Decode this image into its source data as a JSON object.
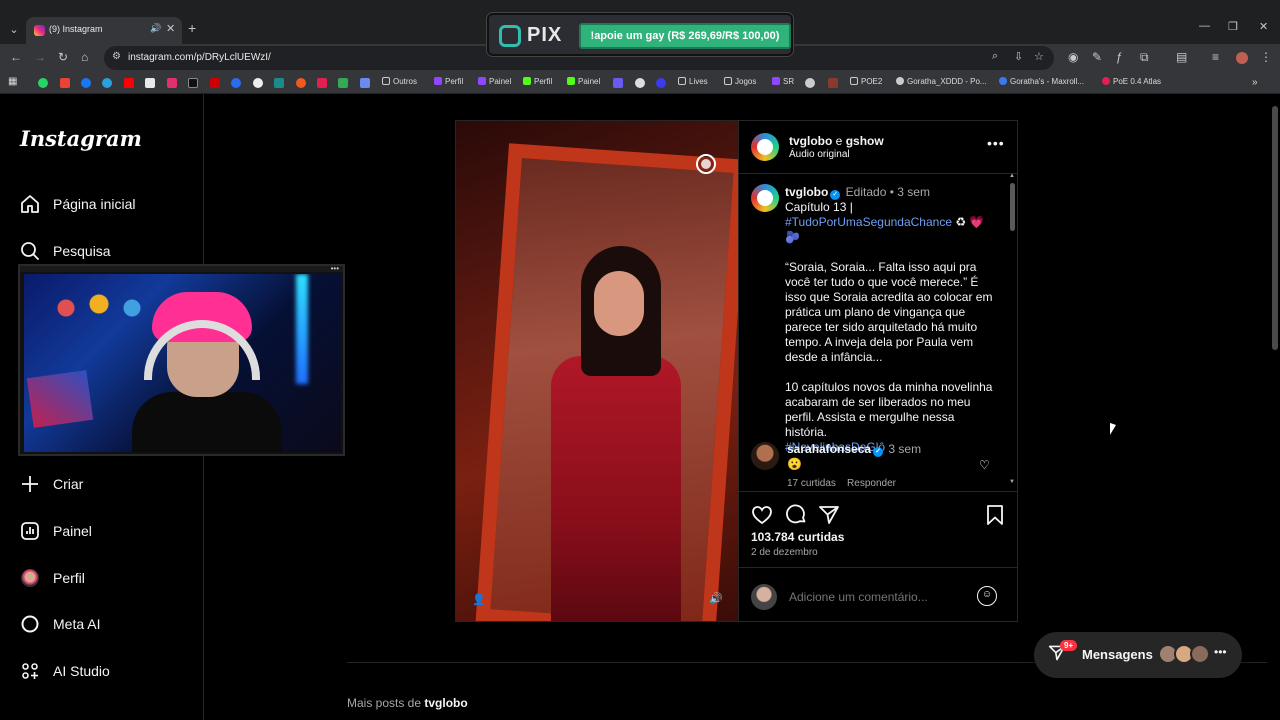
{
  "browser": {
    "tab_title": "(9) Instagram",
    "url": "instagram.com/p/DRyLclUEWzI/",
    "window_controls": [
      "—",
      "❐",
      "✕"
    ]
  },
  "overlay": {
    "pix_label": "PIX",
    "pix_button": "!apoie um gay (R$ 269,69/R$ 100,00)"
  },
  "bookmarks": [
    "Outros",
    "Perfil",
    "Painel",
    "Perfil",
    "Painel",
    "Lives",
    "Jogos",
    "SR",
    "POE2",
    "Goratha_XDDD - Po...",
    "Goratha's - Maxroll...",
    "PoE 0.4 Atlas"
  ],
  "sidebar": {
    "logo": "Instagram",
    "items": [
      {
        "label": "Página inicial",
        "icon": "home-icon"
      },
      {
        "label": "Pesquisa",
        "icon": "search-icon"
      },
      {
        "label": "Criar",
        "icon": "plus-icon"
      },
      {
        "label": "Painel",
        "icon": "dashboard-icon"
      },
      {
        "label": "Perfil",
        "icon": "profile-avatar-icon"
      },
      {
        "label": "Meta AI",
        "icon": "meta-ai-icon"
      },
      {
        "label": "AI Studio",
        "icon": "ai-studio-icon"
      }
    ]
  },
  "post": {
    "header": {
      "user1": "tvglobo",
      "conj": "e",
      "user2": "gshow",
      "audio": "Áudio original"
    },
    "caption": {
      "username": "tvglobo",
      "edited": "Editado",
      "time": "3 sem",
      "line1": "Capítulo 13 |",
      "hashtag1": "#TudoPorUmaSegundaChance",
      "emojis": "♻ 💗 🫐",
      "para1": "“Soraia, Soraia... Falta isso aqui pra você ter tudo o que você merece.” É isso que Soraia acredita ao colocar em prática um plano de vingança que parece ter sido arquitetado há muito tempo. A inveja dela por Paula vem desde a infância...",
      "para2": "10 capítulos novos da minha novelinha acabaram de ser liberados no meu perfil. Assista e mergulhe nessa história.",
      "hashtag2": "#NovelinhasDaGlô"
    },
    "comment": {
      "username": "sarahafonseca",
      "time": "3 sem",
      "text": "😮",
      "likes": "17 curtidas",
      "reply": "Responder"
    },
    "likes": "103.784 curtidas",
    "date": "2 de dezembro",
    "add_comment_placeholder": "Adicione um comentário..."
  },
  "more_from": {
    "prefix": "Mais posts de",
    "user": "tvglobo"
  },
  "messages": {
    "label": "Mensagens",
    "badge": "9+"
  },
  "colors": {
    "accent_link": "#6f9ff5",
    "verified": "#0095f6",
    "badge": "#ff3040",
    "pix_green": "#2fb37a"
  }
}
